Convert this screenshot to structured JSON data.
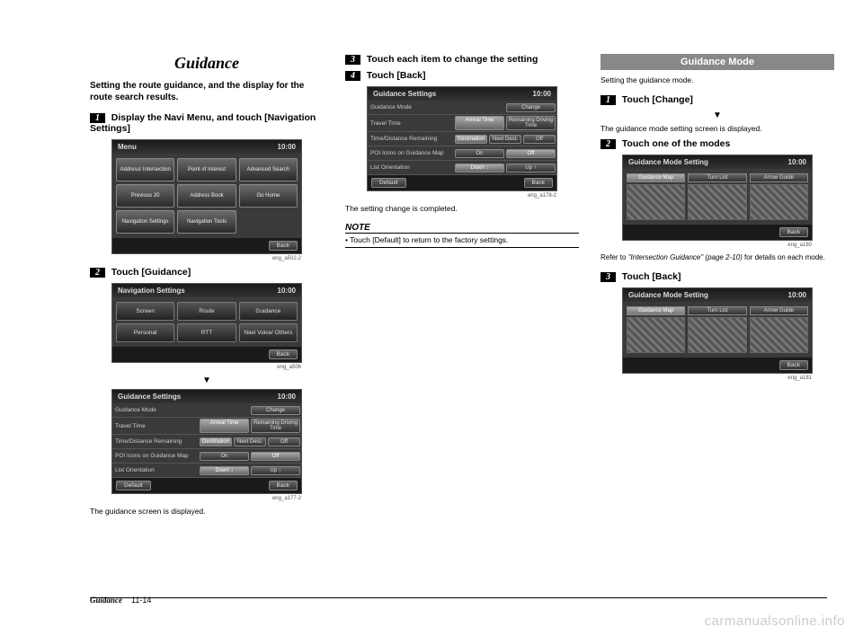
{
  "col1": {
    "title": "Guidance",
    "intro": "Setting the route guidance, and the display for the route search results.",
    "step1_num": "1",
    "step1_text": "Display the Navi Menu, and touch [Navigation Settings]",
    "screen1": {
      "header_left": "Menu",
      "header_right": "10:00",
      "buttons": [
        "Address/\nIntersection",
        "Point of\nInterest",
        "Advanced\nSearch",
        "Previous\n20",
        "Address\nBook",
        "Go Home",
        "Navigation\nSettings",
        "Navigation\nTools",
        ""
      ],
      "footer_right": "Back",
      "ref": "eng_a502-2"
    },
    "step2_num": "2",
    "step2_text": "Touch [Guidance]",
    "screen2a": {
      "header_left": "Navigation Settings",
      "header_right": "10:00",
      "buttons": [
        "Screen",
        "Route",
        "Guidance",
        "Personal",
        "RTT",
        "Navi Voice/\nOthers"
      ],
      "footer_right": "Back",
      "ref": "eng_a506"
    },
    "screen2b": {
      "header_left": "Guidance Settings",
      "header_right": "10:00",
      "rows": [
        {
          "label": "Guidance Mode",
          "opts": [
            "",
            "Change"
          ]
        },
        {
          "label": "Travel Time",
          "opts": [
            "Arrival Time",
            "Remaining Driving Time"
          ]
        },
        {
          "label": "Time/Distance Remaining",
          "opts": [
            "Destination",
            "Next Dest.",
            "Off"
          ]
        },
        {
          "label": "POI Icons on Guidance Map",
          "opts": [
            "On",
            "Off"
          ]
        },
        {
          "label": "List Orientation",
          "opts": [
            "Down ↓",
            "Up ↑"
          ]
        }
      ],
      "footer_left": "Default",
      "footer_right": "Back",
      "ref": "eng_a177-2"
    },
    "caption2": "The guidance screen is displayed."
  },
  "col2": {
    "step3_num": "3",
    "step3_text": "Touch each item to change the setting",
    "step4_num": "4",
    "step4_text": "Touch [Back]",
    "screen3": {
      "header_left": "Guidance Settings",
      "header_right": "10:00",
      "rows": [
        {
          "label": "Guidance Mode",
          "opts": [
            "",
            "Change"
          ]
        },
        {
          "label": "Travel Time",
          "opts": [
            "Arrival Time",
            "Remaining Driving Time"
          ]
        },
        {
          "label": "Time/Distance Remaining",
          "opts": [
            "Destination",
            "Next Dest.",
            "Off"
          ]
        },
        {
          "label": "POI Icons on Guidance Map",
          "opts": [
            "On",
            "Off"
          ]
        },
        {
          "label": "List Orientation",
          "opts": [
            "Down ↓",
            "Up ↑"
          ]
        }
      ],
      "footer_left": "Default",
      "footer_right": "Back",
      "ref": "eng_a178-2"
    },
    "caption3": "The setting change is completed.",
    "note_label": "NOTE",
    "note_body": "• Touch [Default] to return to the factory settings."
  },
  "col3": {
    "section": "Guidance Mode",
    "intro": "Setting the guidance mode.",
    "step1_num": "1",
    "step1_text": "Touch [Change]",
    "sub1": "The guidance mode setting screen is displayed.",
    "step2_num": "2",
    "step2_text": "Touch one of the modes",
    "screenA": {
      "header_left": "Guidance Mode Setting",
      "header_right": "10:00",
      "modes": [
        "Guidance Map",
        "Turn List",
        "Arrow Guide"
      ],
      "footer_right": "Back",
      "ref": "eng_a180"
    },
    "ref_text_a": "Refer to ",
    "ref_text_b": "\"Intersection Guidance\" (page 2-10)",
    "ref_text_c": " for details on each mode.",
    "step3_num": "3",
    "step3_text": "Touch [Back]",
    "screenB": {
      "header_left": "Guidance Mode Setting",
      "header_right": "10:00",
      "modes": [
        "Guidance Map",
        "Turn List",
        "Arrow Guide"
      ],
      "footer_right": "Back",
      "ref": "eng_a181"
    }
  },
  "footer": {
    "title": "Guidance",
    "page": "11-14"
  },
  "watermark": "carmanualsonline.info",
  "arrow": "▼"
}
